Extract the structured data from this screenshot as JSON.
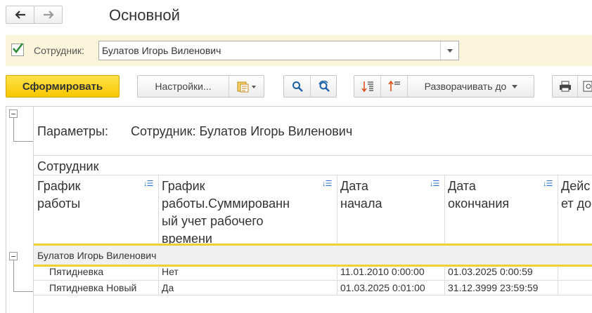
{
  "window": {
    "title": "Основной"
  },
  "nav": {
    "back_icon": "arrow-left-icon",
    "forward_icon": "arrow-right-icon"
  },
  "filter": {
    "checked": true,
    "label": "Сотрудник:",
    "value": "Булатов Игорь Виленович"
  },
  "toolbar": {
    "generate_label": "Сформировать",
    "settings_label": "Настройки...",
    "expand_label": "Разворачивать до"
  },
  "report": {
    "params_label": "Параметры:",
    "params_value": "Сотрудник: Булатов Игорь Виленович",
    "grouping_header": "Сотрудник",
    "columns": [
      {
        "line1": "График",
        "line2": "работы",
        "line3": "",
        "line4": ""
      },
      {
        "line1": "График",
        "line2": "работы.Суммированн",
        "line3": "ый учет рабочего",
        "line4": "времени"
      },
      {
        "line1": "Дата",
        "line2": "начала",
        "line3": "",
        "line4": ""
      },
      {
        "line1": "Дата",
        "line2": "окончания",
        "line3": "",
        "line4": ""
      },
      {
        "line1": "Дейс",
        "line2": "ет до",
        "line3": "",
        "line4": ""
      }
    ],
    "group": "Булатов Игорь Виленович",
    "rows": [
      {
        "schedule": "Пятидневка",
        "summarized": "Нет",
        "start": "11.01.2010 0:00:00",
        "end": "01.03.2025 0:00:59"
      },
      {
        "schedule": "Пятидневка Новый",
        "summarized": "Да",
        "start": "01.03.2025 0:01:00",
        "end": "31.12.3999 23:59:59"
      }
    ]
  },
  "colors": {
    "accent": "#f6c700",
    "filter_bg": "#fbf5dc",
    "check": "#2e8b3a"
  }
}
